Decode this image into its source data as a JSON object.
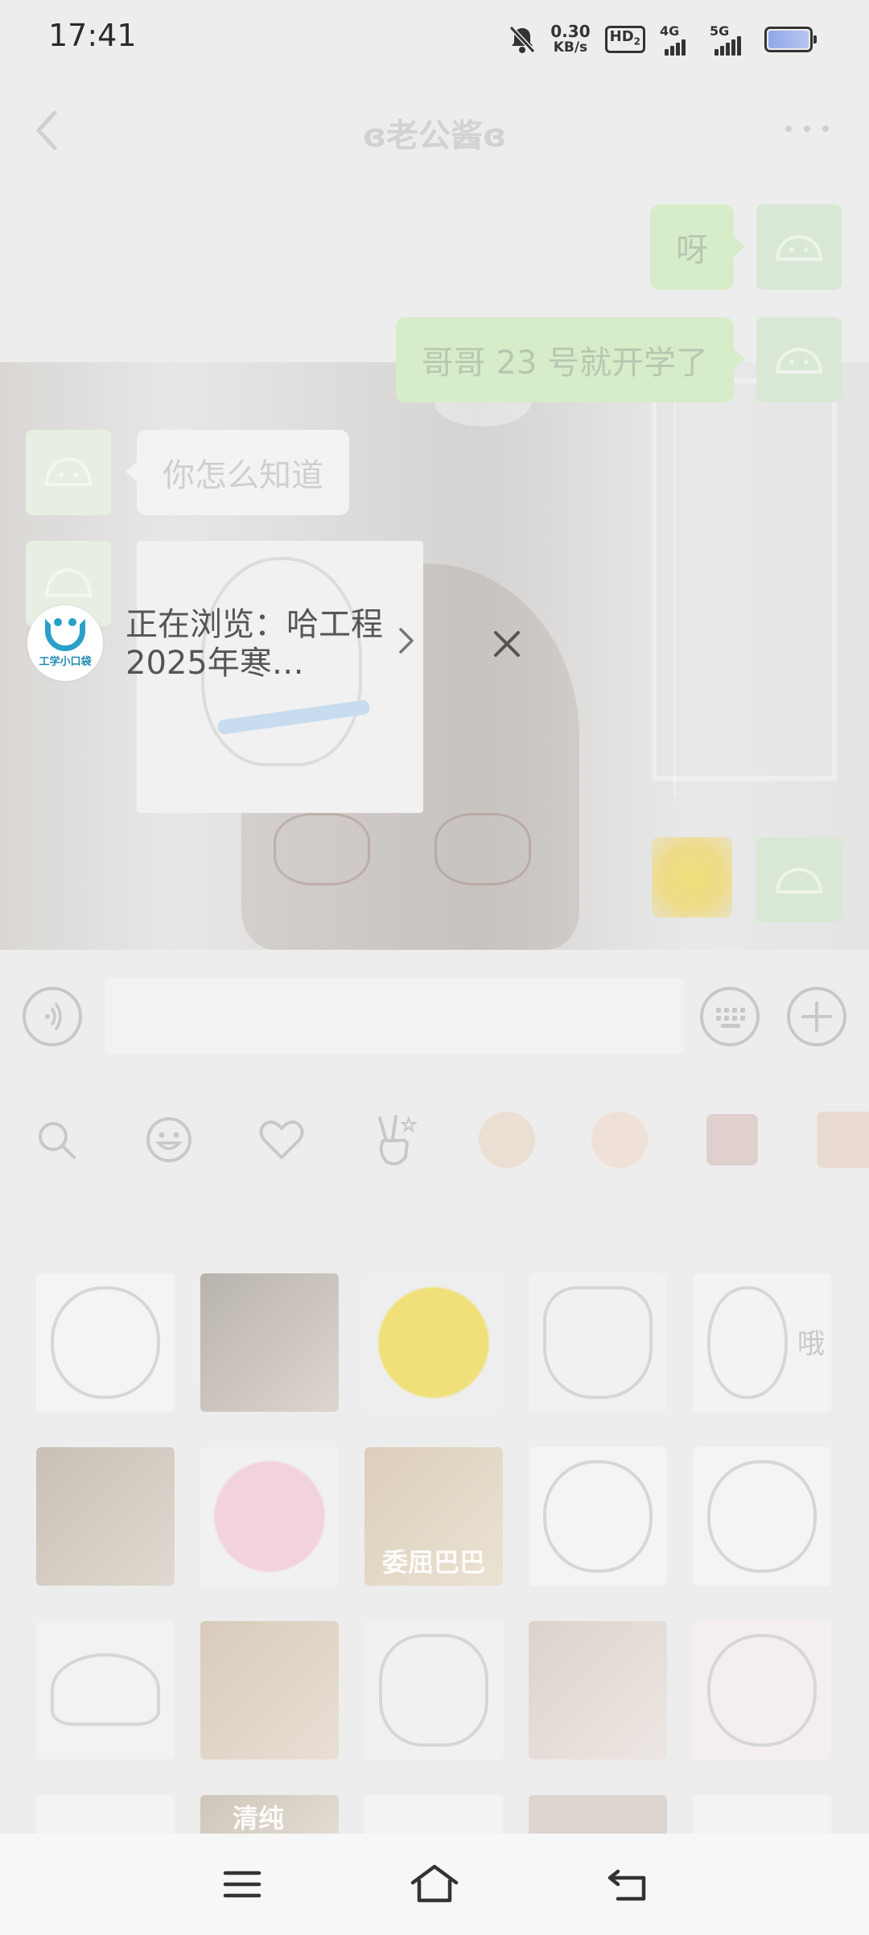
{
  "status_bar": {
    "time": "17:41",
    "net_speed_value": "0.30",
    "net_speed_unit": "KB/s",
    "hd_label": "HD",
    "hd_sub": "2",
    "sig1_label": "4G",
    "sig2_label": "5G"
  },
  "header": {
    "title": "ɞ老公酱ɞ"
  },
  "messages": [
    {
      "sender": "me",
      "text": "呀"
    },
    {
      "sender": "me",
      "text": "哥哥 23 号就开学了"
    },
    {
      "sender": "them",
      "text": "你怎么知道"
    },
    {
      "sender": "them",
      "type": "sticker"
    },
    {
      "sender": "me",
      "type": "sticker"
    }
  ],
  "floating_window": {
    "logo_text": "工学小口袋",
    "text": "正在浏览：哈工程2025年寒…"
  },
  "input": {
    "value": ""
  },
  "emoji_tabs": [
    "search-icon",
    "smiley-icon",
    "heart-icon",
    "victory-hand-icon",
    "sticker-1",
    "sticker-2",
    "sticker-3",
    "sticker-4"
  ],
  "sticker_grid": {
    "captions": {
      "cell_5": "哦",
      "cell_8": "委屈巴巴",
      "cell_16": "清纯"
    }
  },
  "colors": {
    "accent_green": "#95ec69",
    "logo_blue": "#2aa0c8"
  }
}
